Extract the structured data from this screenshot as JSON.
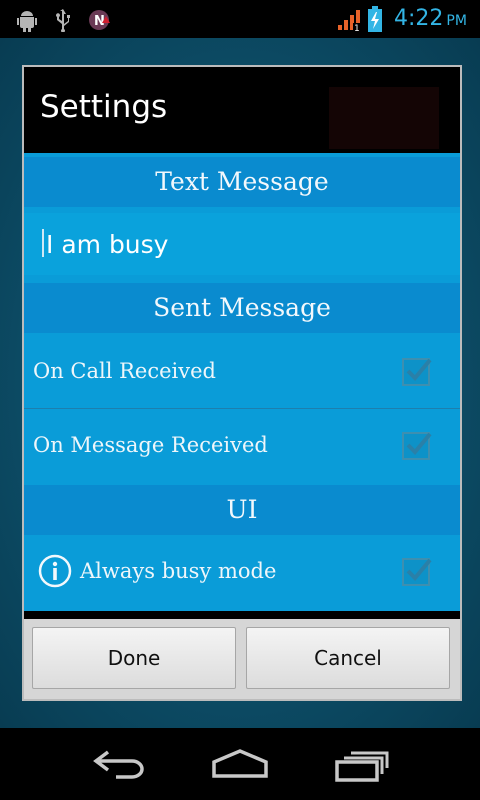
{
  "status_bar": {
    "time": "4:22",
    "ampm": "PM",
    "icons": [
      "android-debug-icon",
      "usb-icon",
      "notification-n-icon",
      "signal-icon",
      "battery-charging-icon"
    ],
    "accent_color": "#33b5e5"
  },
  "dialog": {
    "title": "Settings",
    "sections": {
      "text_message": {
        "header": "Text Message",
        "value": "I am busy"
      },
      "sent_message": {
        "header": "Sent Message",
        "items": [
          {
            "label": "On Call Received",
            "checked": true
          },
          {
            "label": "On Message Received",
            "checked": true
          }
        ]
      },
      "ui": {
        "header": "UI",
        "items": [
          {
            "label": "Always busy mode",
            "checked": true,
            "icon": "info-icon"
          }
        ]
      }
    },
    "buttons": {
      "done": "Done",
      "cancel": "Cancel"
    }
  },
  "navigation": {
    "icons": [
      "back-icon",
      "home-icon",
      "recent-apps-icon"
    ]
  },
  "colors": {
    "content_bg": "#0a9cd8",
    "header_bg": "#0a8bcf",
    "check_color": "#2a80a8"
  }
}
